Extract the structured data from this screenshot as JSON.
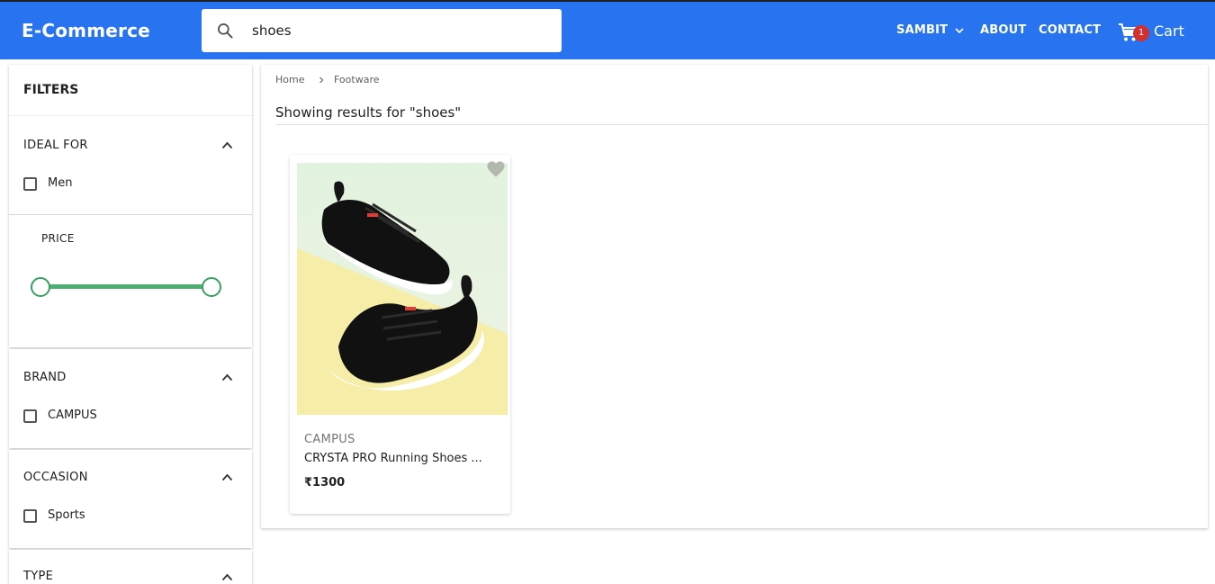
{
  "header": {
    "logo": "E-Commerce",
    "search": {
      "value": "shoes",
      "placeholder": ""
    },
    "nav": {
      "user": "SAMBIT",
      "about": "ABOUT",
      "contact": "CONTACT"
    },
    "cart": {
      "label": "Cart",
      "count": "1"
    },
    "colors": {
      "bar": "#2874f0",
      "badge": "#d32f2f"
    }
  },
  "sidebar": {
    "title": "FILTERS",
    "ideal_for": {
      "title": "IDEAL FOR",
      "options": [
        "Men"
      ]
    },
    "price": {
      "title": "PRICE"
    },
    "brand": {
      "title": "BRAND",
      "options": [
        "CAMPUS"
      ]
    },
    "occasion": {
      "title": "OCCASION",
      "options": [
        "Sports"
      ]
    },
    "type": {
      "title": "TYPE"
    }
  },
  "main": {
    "breadcrumb": [
      "Home",
      "Footware"
    ],
    "results_title": "Showing results for \"shoes\"",
    "products": [
      {
        "brand": "CAMPUS",
        "name": "CRYSTA PRO Running Shoes ...",
        "price": "₹1300",
        "image": "black-running-shoes-icon"
      }
    ]
  }
}
